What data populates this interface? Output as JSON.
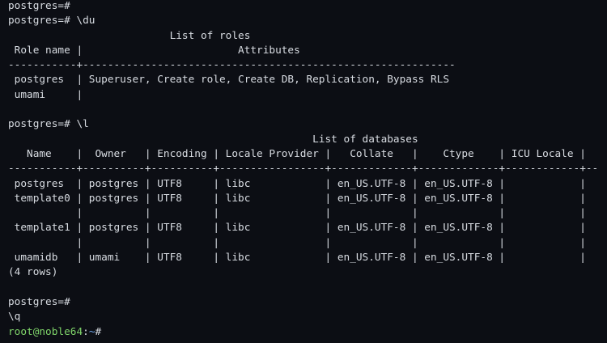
{
  "colors": {
    "background": "#0c0e14",
    "text": "#d8dce2",
    "user_host": "#7fd46a",
    "path": "#6fa5e8"
  },
  "terminal": {
    "lines": [
      "postgres=#",
      "postgres=# \\du",
      "                          List of roles",
      " Role name |                         Attributes",
      "-----------+------------------------------------------------------------",
      " postgres  | Superuser, Create role, Create DB, Replication, Bypass RLS",
      " umami     |",
      "",
      "postgres=# \\l",
      "                                                 List of databases",
      "   Name    |  Owner   | Encoding | Locale Provider |   Collate   |    Ctype    | ICU Locale |",
      "-----------+----------+----------+-----------------+-------------+-------------+------------+--",
      " postgres  | postgres | UTF8     | libc            | en_US.UTF-8 | en_US.UTF-8 |            |",
      " template0 | postgres | UTF8     | libc            | en_US.UTF-8 | en_US.UTF-8 |            |",
      "           |          |          |                 |             |             |            |",
      " template1 | postgres | UTF8     | libc            | en_US.UTF-8 | en_US.UTF-8 |            |",
      "           |          |          |                 |             |             |            |",
      " umamidb   | umami    | UTF8     | libc            | en_US.UTF-8 | en_US.UTF-8 |            |",
      "(4 rows)",
      "",
      "postgres=#",
      "\\q"
    ],
    "final_prompt": {
      "user_host": "root@noble64",
      "separator": ":",
      "path": "~",
      "symbol": "#"
    }
  }
}
